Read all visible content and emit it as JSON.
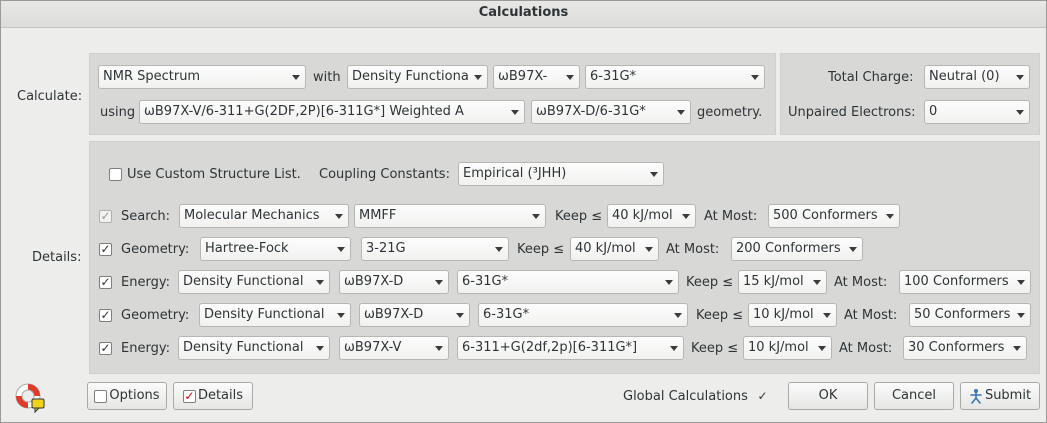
{
  "window": {
    "title": "Calculations"
  },
  "calculate": {
    "label": "Calculate:",
    "type": "NMR Spectrum",
    "with_label": "with",
    "method": "Density Functiona",
    "functional": "ωB97X-",
    "basis": "6-31G*",
    "using_label": "using",
    "using_method": "ωB97X-V/6-311+G(2DF,2P)[6-311G*] Weighted A",
    "geometry_method": "ωB97X-D/6-31G*",
    "geometry_label": "geometry."
  },
  "charge": {
    "total_charge_label": "Total Charge:",
    "total_charge": "Neutral (0)",
    "unpaired_label": "Unpaired Electrons:",
    "unpaired": "0"
  },
  "details": {
    "label": "Details:",
    "custom_structure_label": "Use Custom Structure List.",
    "custom_structure_checked": false,
    "coupling_label": "Coupling Constants:",
    "coupling_value": "Empirical (³JHH)",
    "keep_label": "Keep ≤",
    "at_most_label": "At Most:",
    "rows": [
      {
        "checked": true,
        "disabled": true,
        "label": "Search:",
        "method": "Molecular Mechanics",
        "basis": "MMFF",
        "keep": "40 kJ/mol",
        "at_most": "500 Conformers"
      },
      {
        "checked": true,
        "disabled": false,
        "label": "Geometry:",
        "method": "Hartree-Fock",
        "basis": "3-21G",
        "keep": "40 kJ/mol",
        "at_most": "200 Conformers"
      },
      {
        "checked": true,
        "disabled": false,
        "label": "Energy:",
        "method": "Density Functional",
        "functional": "ωB97X-D",
        "basis": "6-31G*",
        "keep": "15 kJ/mol",
        "at_most": "100 Conformers"
      },
      {
        "checked": true,
        "disabled": false,
        "label": "Geometry:",
        "method": "Density Functional",
        "functional": "ωB97X-D",
        "basis": "6-31G*",
        "keep": "10 kJ/mol",
        "at_most": "50 Conformers"
      },
      {
        "checked": true,
        "disabled": false,
        "label": "Energy:",
        "method": "Density Functional",
        "functional": "ωB97X-V",
        "basis": "6-311+G(2df,2p)[6-311G*]",
        "keep": "10 kJ/mol",
        "at_most": "30 Conformers"
      }
    ]
  },
  "footer": {
    "help_icon": "lifebuoy-icon",
    "options_label": "Options",
    "details_label": "Details",
    "global_label": "Global Calculations",
    "global_checked": true,
    "ok_label": "OK",
    "cancel_label": "Cancel",
    "submit_label": "Submit",
    "submit_icon": "submit-figure-icon"
  }
}
